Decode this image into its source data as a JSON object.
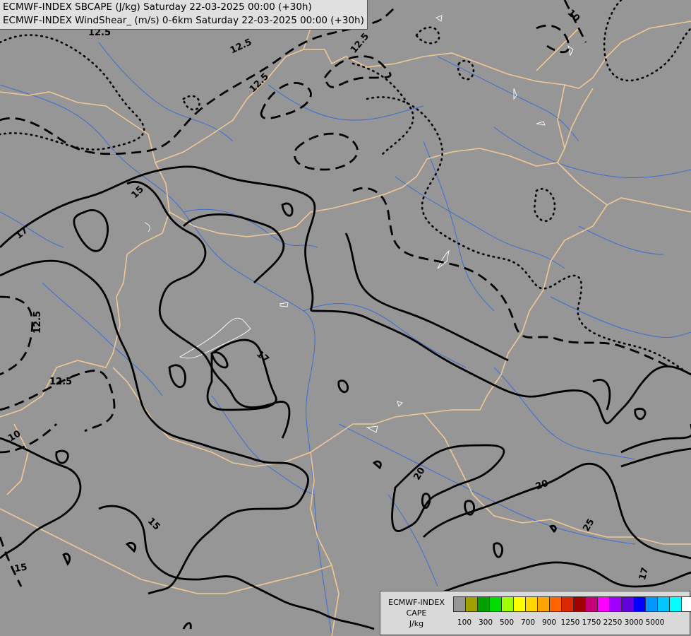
{
  "titles": {
    "line1": "ECMWF-INDEX SBCAPE (J/kg) Saturday 22-03-2025 00:00 (+30h)",
    "line2": "ECMWF-INDEX WindShear_ (m/s) 0-6km Saturday 22-03-2025 00:00 (+30h)"
  },
  "legend": {
    "model": "ECMWF-INDEX",
    "field": "CAPE",
    "unit": "J/kg",
    "colors": [
      "#969696",
      "#a0a000",
      "#00a000",
      "#00dc00",
      "#a0ff00",
      "#ffff00",
      "#ffd700",
      "#ffa500",
      "#ff6400",
      "#dc2800",
      "#a00000",
      "#c80078",
      "#ff00ff",
      "#a000ff",
      "#6400dc",
      "#0000ff",
      "#0096ff",
      "#00c8ff",
      "#00ffff",
      "#ffffff"
    ],
    "ticks": [
      "100",
      "300",
      "500",
      "700",
      "900",
      "1250",
      "1750",
      "2250",
      "3000",
      "5000"
    ]
  },
  "contour_labels": [
    "12.5",
    "12.5",
    "12.5",
    "12.5",
    "10",
    "15",
    "17",
    "12.5",
    "12.5",
    "10",
    "17",
    "20",
    "20",
    "25",
    "15",
    "15",
    "17"
  ],
  "colors": {
    "background": "#969696",
    "borders": "#f0c896",
    "rivers": "#3c6ed2",
    "contours": "#000000"
  }
}
